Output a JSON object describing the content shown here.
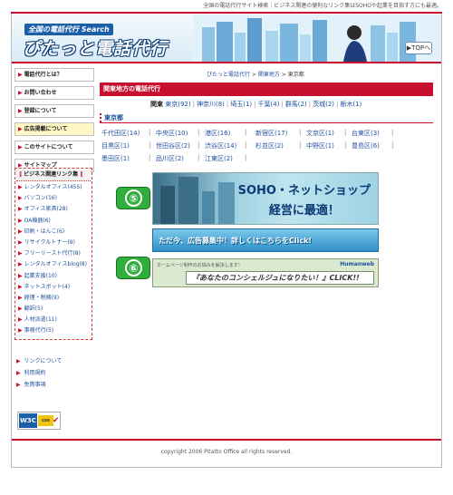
{
  "header": {
    "tagline": "全国の電話代行サイト検索｜ビジネス関連の便利なリンク集はSOHOや起業を目指す方にも最適。",
    "logo_sub": "全国の電話代行 Search",
    "logo_main": "ぴたっと電話代行",
    "top_button": "▶TOPへ"
  },
  "sidebar": {
    "nav": [
      {
        "label": "電話代行とは？",
        "active": false
      },
      {
        "label": "お問い合わせ",
        "active": false
      },
      {
        "label": "登録について",
        "active": false
      },
      {
        "label": "広告掲載について",
        "active": true
      },
      {
        "label": "このサイトについて",
        "active": false
      },
      {
        "label": "サイトマップ",
        "active": false
      }
    ],
    "biz_title": "ビジネス関連リンク集",
    "biz_links": [
      "レンタルオフィス(455)",
      "バソコン(16)",
      "オフィス家具(28)",
      "OA機器(6)",
      "印刷・はんこ(6)",
      "リサイクルトナー(9)",
      "フリーリースト代行(8)",
      "レンタルオフィスblog(8)",
      "起業支援(10)",
      "ネットスボット(4)",
      "経理・税務(9)",
      "翻訳(5)",
      "人材派遣(11)",
      "事務代行(5)"
    ],
    "footer_links": [
      "リンクについて",
      "利用規約",
      "免責事項"
    ],
    "w3c": {
      "left": "W3C",
      "right": "css"
    }
  },
  "main": {
    "breadcrumb": [
      "ぴたっと電話代行",
      "関東地方",
      "東京都"
    ],
    "breadcrumb_sep": " > ",
    "section_title": "関東地方の電話代行",
    "regions": [
      {
        "label": "関東",
        "current": true
      },
      {
        "label": "東京(92)",
        "current": false
      },
      {
        "label": "神奈川(8)",
        "current": false
      },
      {
        "label": "埼玉(1)",
        "current": false
      },
      {
        "label": "千葉(4)",
        "current": false
      },
      {
        "label": "群馬(2)",
        "current": false
      },
      {
        "label": "茨城(2)",
        "current": false
      },
      {
        "label": "栃木(1)",
        "current": false
      }
    ],
    "tokyo_heading": "東京都",
    "ward_rows": [
      [
        "千代田区(14)",
        "中央区(10)",
        "港区(16)",
        "新宿区(17)",
        "文京区(1)",
        "台東区(3)"
      ],
      [
        "目黒区(1)",
        "世田谷区(2)",
        "渋谷区(14)",
        "杉並区(2)",
        "中野区(1)",
        "豊島区(6)"
      ],
      [
        "墨田区(1)",
        "品川区(2)",
        "江東区(2)"
      ]
    ]
  },
  "ads": {
    "badge5": "⑤",
    "ad5_line1": "SOHO・ネットショップ",
    "ad5_line2": "経営に最適！",
    "recruit": "ただ今、広告募集中！詳しくはこちらをClick!",
    "badge6": "⑥",
    "ad6_top": "ホームページ制作のお悩みを解決します！",
    "ad6_brand": "Humanweb",
    "ad6_main": "『あなたのコンシェルジュになりたい！』CLICK!!"
  },
  "footer": {
    "copyright": "copyright 2006 Pitatto Office all rights reserved."
  },
  "colors": {
    "accent_red": "#c8102e",
    "link_blue": "#1d4f9e",
    "badge_green": "#2fae3c"
  }
}
